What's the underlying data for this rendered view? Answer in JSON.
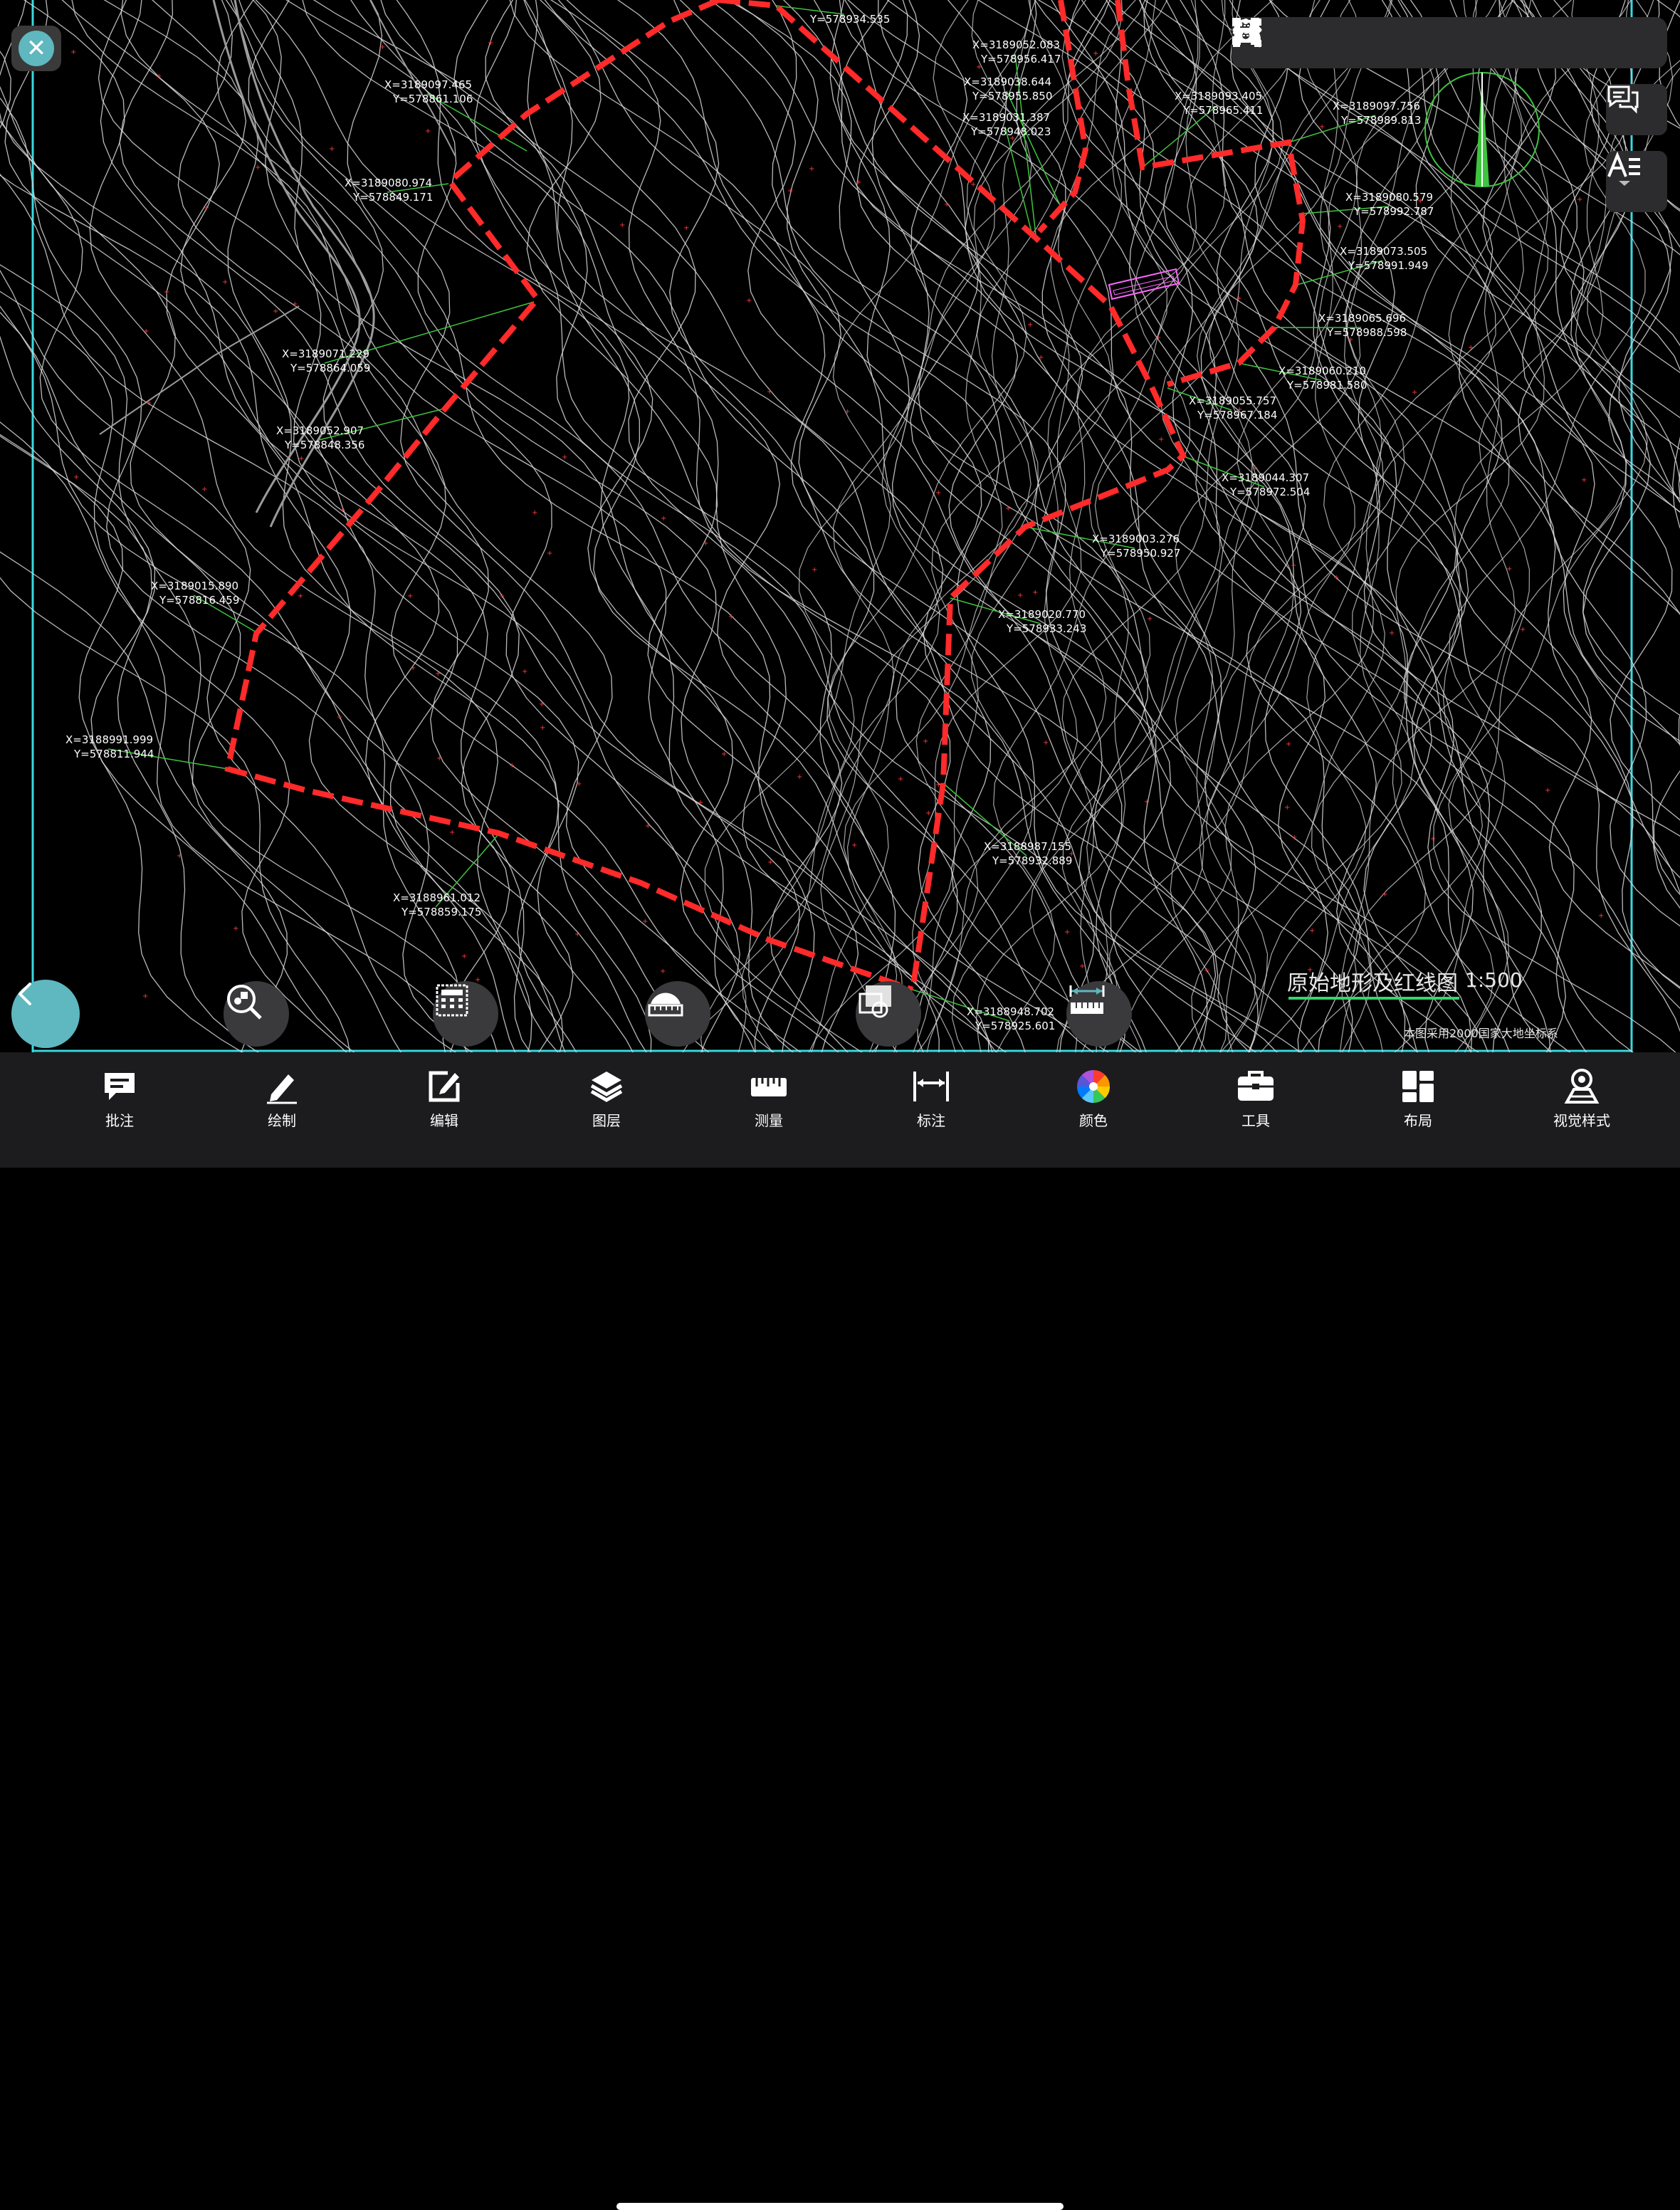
{
  "drawing": {
    "title": "原始地形及红线图",
    "scale": "1:500",
    "note": "本图采用2000国家大地坐标系",
    "colors": {
      "contour": "#d9d9d9",
      "redline": "#ff2a2a",
      "frame": "#39d9e0",
      "leader": "#3ec43e",
      "accent": "#5fb7bf"
    },
    "coordinate_labels": [
      {
        "x": "X=3189097.465",
        "y": "Y=578861.106"
      },
      {
        "x": "X=3189080.974",
        "y": "Y=578849.171"
      },
      {
        "x": "X=3189071.229",
        "y": "Y=578864.059"
      },
      {
        "x": "X=3189052.907",
        "y": "Y=578848.356"
      },
      {
        "x": "X=3189015.890",
        "y": "Y=578816.459"
      },
      {
        "x": "X=3188991.999",
        "y": "Y=578811.944"
      },
      {
        "x": "X=3188961.012",
        "y": "Y=578859.175"
      },
      {
        "x": "X=3189052.083",
        "y": "Y=578956.417"
      },
      {
        "x": "X=3189038.644",
        "y": "Y=578955.850"
      },
      {
        "x": "X=3189031.387",
        "y": "Y=578948.023"
      },
      {
        "x": "X=3189093.405",
        "y": "Y=578965.411"
      },
      {
        "x": "X=3189097.756",
        "y": "Y=578989.813"
      },
      {
        "x": "X=3189080.579",
        "y": "Y=578992.787"
      },
      {
        "x": "X=3189073.505",
        "y": "Y=578991.949"
      },
      {
        "x": "X=3189065.696",
        "y": "Y=578988.598"
      },
      {
        "x": "X=3189060.210",
        "y": "Y=578981.580"
      },
      {
        "x": "X=3189055.757",
        "y": "Y=578967.184"
      },
      {
        "x": "X=3189044.307",
        "y": "Y=578972.504"
      },
      {
        "x": "X=3189003.276",
        "y": "Y=578950.927"
      },
      {
        "x": "X=3189020.770",
        "y": "Y=578933.243"
      },
      {
        "x": "X=3188987.155",
        "y": "Y=578932.889"
      },
      {
        "x": "X=3188948.702",
        "y": "Y=578925.601"
      },
      {
        "x": "",
        "y": "Y=578934.535"
      }
    ]
  },
  "top_toolbar": [
    {
      "name": "save",
      "icon": "save-icon"
    },
    {
      "name": "undo",
      "icon": "undo-icon"
    },
    {
      "name": "redo",
      "icon": "redo-icon"
    },
    {
      "name": "extents",
      "icon": "zoom-extents-icon"
    },
    {
      "name": "zoom-window",
      "icon": "zoom-window-icon"
    },
    {
      "name": "fullscreen",
      "icon": "fullscreen-icon"
    },
    {
      "name": "more",
      "icon": "more-icon"
    }
  ],
  "bottom_nav": [
    {
      "label": "批注",
      "icon": "comment-icon"
    },
    {
      "label": "绘制",
      "icon": "pencil-icon"
    },
    {
      "label": "编辑",
      "icon": "edit-icon"
    },
    {
      "label": "图层",
      "icon": "layers-icon"
    },
    {
      "label": "测量",
      "icon": "ruler-icon"
    },
    {
      "label": "标注",
      "icon": "dimension-icon"
    },
    {
      "label": "颜色",
      "icon": "color-wheel-icon"
    },
    {
      "label": "工具",
      "icon": "toolbox-icon"
    },
    {
      "label": "布局",
      "icon": "layout-icon"
    },
    {
      "label": "视觉样式",
      "icon": "visual-style-icon"
    }
  ]
}
